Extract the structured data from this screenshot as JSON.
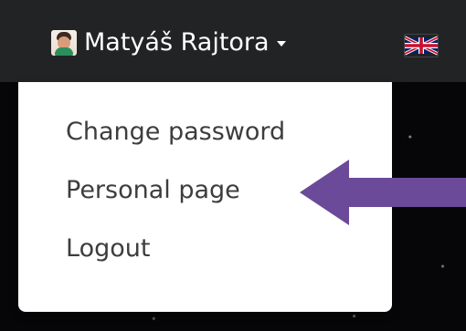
{
  "header": {
    "user_name": "Matyáš Rajtora",
    "avatar_icon": "user-avatar",
    "caret_icon": "caret-down-icon",
    "language_icon": "uk-flag-icon"
  },
  "dropdown": {
    "items": [
      {
        "label": "Change password"
      },
      {
        "label": "Personal page"
      },
      {
        "label": "Logout"
      }
    ]
  },
  "colors": {
    "navbar": "#222325",
    "dropdown": "#ffffff",
    "arrow": "#6a4a99",
    "text": "#3d3d3d"
  }
}
